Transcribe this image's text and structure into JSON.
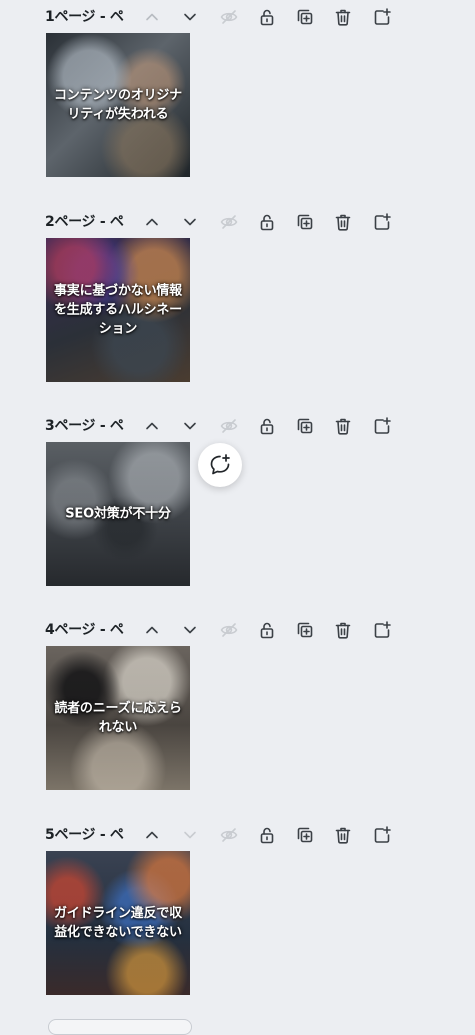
{
  "pages": [
    {
      "label": "1ページ - ペ",
      "caption": "コンテンツのオリジナリティが失われる",
      "colors": [
        "#3a4048",
        "#6f7478",
        "#1e2428",
        "#8a7a68"
      ],
      "up_dim": true,
      "down_dim": false
    },
    {
      "label": "2ページ - ペ",
      "caption": "事実に基づかない情報を生成するハルシネーション",
      "colors": [
        "#3a2a56",
        "#8c3f3a",
        "#2b3038",
        "#c27a4a"
      ],
      "up_dim": false,
      "down_dim": false
    },
    {
      "label": "3ページ - ペ",
      "caption": "SEO対策が不十分",
      "colors": [
        "#4e5358",
        "#8b9096",
        "#2a2e33",
        "#6e7378"
      ],
      "up_dim": false,
      "down_dim": false
    },
    {
      "label": "4ページ - ペ",
      "caption": "読者のニーズに応えられない",
      "colors": [
        "#5a5550",
        "#9a9288",
        "#2e2a27",
        "#b9b2a8"
      ],
      "up_dim": false,
      "down_dim": false
    },
    {
      "label": "5ページ - ペ",
      "caption": "ガイドライン違反で収益化できないできない",
      "colors": [
        "#24303f",
        "#c24a32",
        "#355b8a",
        "#e0a048"
      ],
      "up_dim": false,
      "down_dim": true
    }
  ],
  "icons": {
    "move_up": "chevron-up-icon",
    "move_down": "chevron-down-icon",
    "hide": "eye-off-icon",
    "lock": "lock-icon",
    "duplicate": "duplicate-icon",
    "delete": "trash-icon",
    "add_page": "add-page-icon",
    "comment": "add-comment-icon"
  }
}
